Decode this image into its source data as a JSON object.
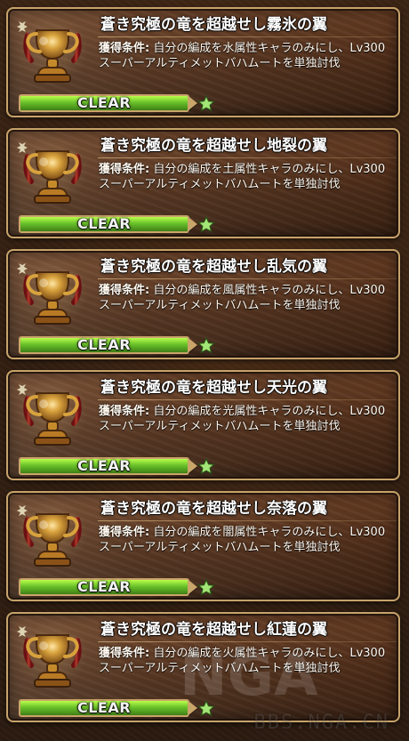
{
  "achievements": [
    {
      "title": "蒼き究極の竜を超越せし霧氷の翼",
      "condition_label": "獲得条件:",
      "condition_text": "自分の編成を水属性キャラのみにし、Lv300 スーパーアルティメットバハムートを単独討伐",
      "status_label": "CLEAR",
      "progress": 1.0,
      "star": "star-icon"
    },
    {
      "title": "蒼き究極の竜を超越せし地裂の翼",
      "condition_label": "獲得条件:",
      "condition_text": "自分の編成を土属性キャラのみにし、Lv300 スーパーアルティメットバハムートを単独討伐",
      "status_label": "CLEAR",
      "progress": 1.0,
      "star": "star-icon"
    },
    {
      "title": "蒼き究極の竜を超越せし乱気の翼",
      "condition_label": "獲得条件:",
      "condition_text": "自分の編成を風属性キャラのみにし、Lv300 スーパーアルティメットバハムートを単独討伐",
      "status_label": "CLEAR",
      "progress": 1.0,
      "star": "star-icon"
    },
    {
      "title": "蒼き究極の竜を超越せし天光の翼",
      "condition_label": "獲得条件:",
      "condition_text": "自分の編成を光属性キャラのみにし、Lv300 スーパーアルティメットバハムートを単独討伐",
      "status_label": "CLEAR",
      "progress": 1.0,
      "star": "star-icon"
    },
    {
      "title": "蒼き究極の竜を超越せし奈落の翼",
      "condition_label": "獲得条件:",
      "condition_text": "自分の編成を闇属性キャラのみにし、Lv300 スーパーアルティメットバハムートを単独討伐",
      "status_label": "CLEAR",
      "progress": 1.0,
      "star": "star-icon"
    },
    {
      "title": "蒼き究極の竜を超越せし紅蓮の翼",
      "condition_label": "獲得条件:",
      "condition_text": "自分の編成を火属性キャラのみにし、Lv300 スーパーアルティメットバハムートを単独討伐",
      "status_label": "CLEAR",
      "progress": 1.0,
      "star": "star-icon"
    }
  ],
  "watermark": {
    "text": "BBS.NGA.CN",
    "logo_text": "NGA"
  },
  "colors": {
    "border_gold": "#c7a36a",
    "progress_green": "#69c12a",
    "star_green": "#8fe05a"
  }
}
